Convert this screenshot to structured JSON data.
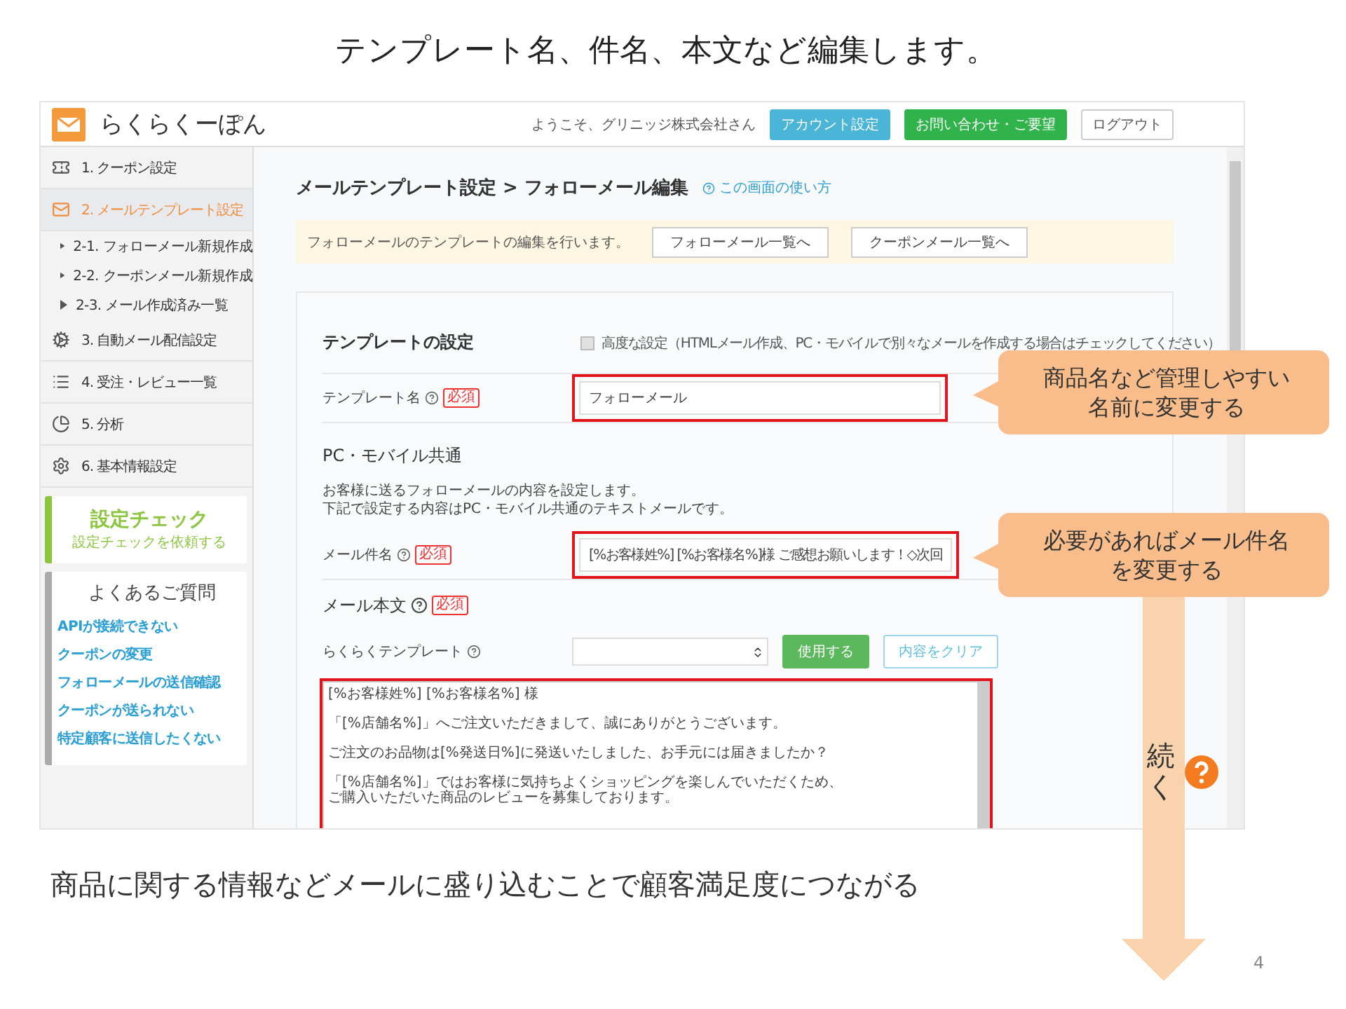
{
  "slide_title": "テンプレート名、件名、本文など編集します。",
  "app": {
    "logo_text": "らくらくーぽん",
    "welcome": "ようこそ、グリニッジ株式会社さん",
    "header_buttons": [
      {
        "label": "アカウント設定",
        "kind": "info"
      },
      {
        "label": "お問い合わせ・ご要望",
        "kind": "success"
      },
      {
        "label": "ログアウト",
        "kind": "default"
      }
    ],
    "sidebar": {
      "items": [
        {
          "label": "1. クーポン設定",
          "selected": false
        },
        {
          "label": "2. メールテンプレート設定",
          "selected": true,
          "children": [
            {
              "label": "2-1. フォローメール新規作成"
            },
            {
              "label": "2-2. クーポンメール新規作成"
            },
            {
              "label": "2-3. メール作成済み一覧"
            }
          ]
        },
        {
          "label": "3. 自動メール配信設定",
          "selected": false
        },
        {
          "label": "4. 受注・レビュー一覧",
          "selected": false
        },
        {
          "label": "5. 分析",
          "selected": false
        },
        {
          "label": "6. 基本情報設定",
          "selected": false
        }
      ],
      "check_card": {
        "title": "設定チェック",
        "subtitle": "設定チェックを依頼する"
      },
      "faq": {
        "title": "よくあるご質問",
        "links": [
          "APIが接続できない",
          "クーポンの変更",
          "フォローメールの送信確認",
          "クーポンが送られない",
          "特定顧客に送信したくない"
        ]
      }
    },
    "main": {
      "page_title": "メールテンプレート設定 > フォローメール編集",
      "help_link": "この画面の使い方",
      "notice": {
        "text": "フォローメールのテンプレートの編集を行います。",
        "buttons": [
          "フォローメール一覧へ",
          "クーポンメール一覧へ"
        ]
      },
      "section_title": "テンプレートの設定",
      "advanced": {
        "label": "高度な設定（HTMLメール作成、PC・モバイルで別々なメールを作成する場合はチェックしてください）",
        "checked": false
      },
      "template_name": {
        "label": "テンプレート名",
        "required": "必須",
        "value": "フォローメール"
      },
      "common_title": "PC・モバイル共通",
      "description": [
        "お客様に送るフォローメールの内容を設定します。",
        "下記で設定する内容はPC・モバイル共通のテキストメールです。"
      ],
      "subject": {
        "label": "メール件名",
        "required": "必須",
        "value": "[%お客様姓%] [%お客様名%]様 ご感想お願いします！◇次回"
      },
      "body_title": "メール本文",
      "body_required": "必須",
      "rakuraku_template": {
        "label": "らくらくテンプレート",
        "buttons": [
          {
            "label": "使用する",
            "kind": "success"
          },
          {
            "label": "内容をクリア",
            "kind": "outline"
          }
        ]
      },
      "body_paragraphs": [
        [
          "[%お客様姓%] [%お客様名%] 様"
        ],
        [
          "「[%店舗名%]」へご注文いただきまして、誠にありがとうございます。"
        ],
        [
          "ご注文のお品物は[%発送日%]に発送いたしました、お手元には届きましたか？"
        ],
        [
          "「[%店舗名%]」ではお客様に気持ちよくショッピングを楽しんでいただくため、",
          "ご購入いただいた商品のレビューを募集しております。"
        ]
      ]
    }
  },
  "callouts": [
    [
      "商品名など管理しやすい",
      "名前に変更する"
    ],
    [
      "必要があればメール件名",
      "を変更する"
    ]
  ],
  "continue_arrow": {
    "label": "続く"
  },
  "caption": "商品に関する情報などメールに盛り込むことで顧客満足度につながる",
  "page_number": "4"
}
